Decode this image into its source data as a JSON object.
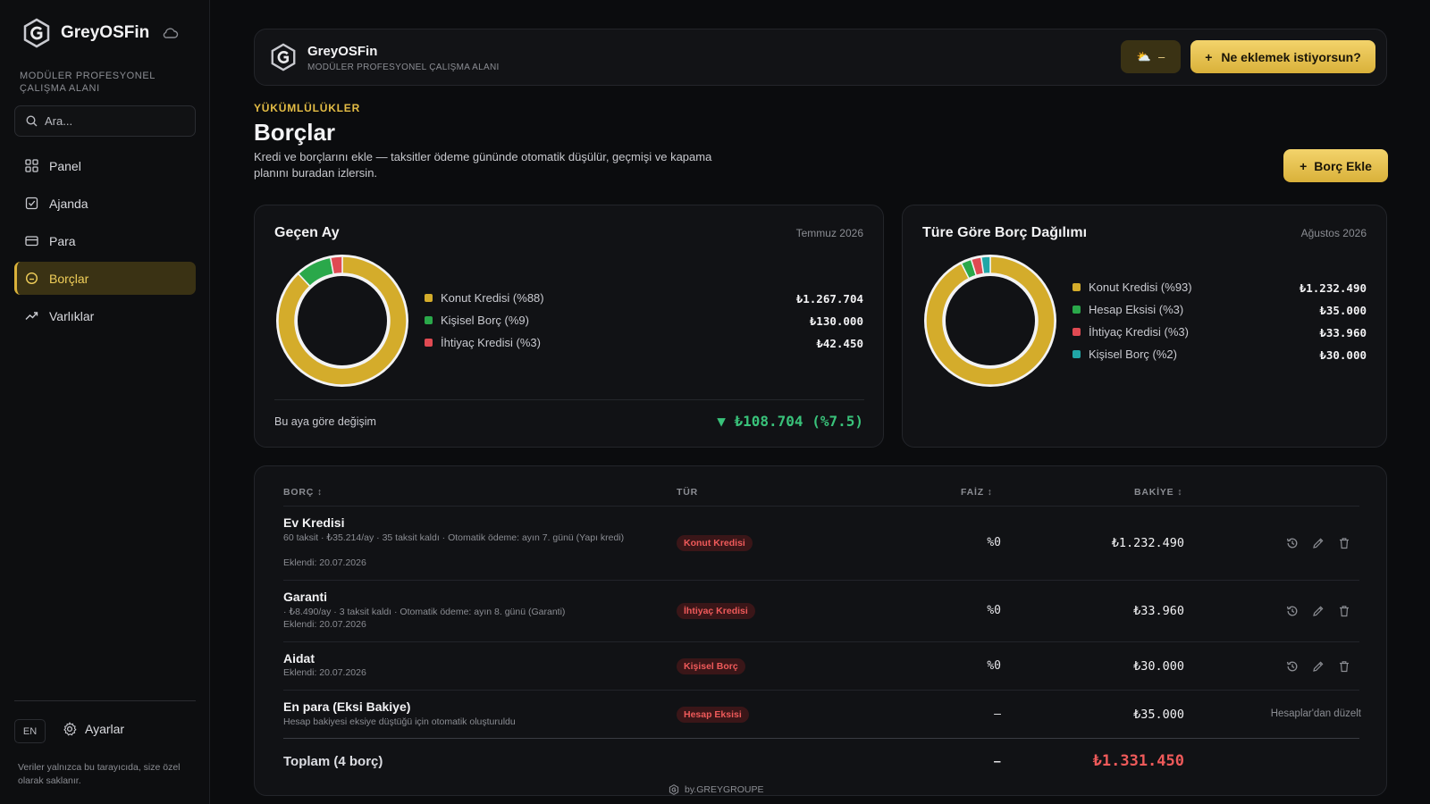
{
  "app": {
    "name": "GreyOSFin",
    "tagline": "MODÜLER PROFESYONEL ÇALIŞMA ALANI"
  },
  "sidebar": {
    "search_placeholder": "Ara...",
    "items": [
      {
        "label": "Panel",
        "icon": "grid-icon"
      },
      {
        "label": "Ajanda",
        "icon": "calendar-check-icon"
      },
      {
        "label": "Para",
        "icon": "card-icon"
      },
      {
        "label": "Borçlar",
        "icon": "circle-icon",
        "active": true
      },
      {
        "label": "Varlıklar",
        "icon": "trend-up-icon"
      }
    ],
    "lang": "EN",
    "settings_label": "Ayarlar",
    "privacy_note": "Veriler yalnızca bu tarayıcıda, size özel olarak saklanır."
  },
  "header": {
    "title": "GreyOSFin",
    "subtitle": "MODÜLER PROFESYONEL ÇALIŞMA ALANI",
    "weather_value": "–",
    "cta_label": "Ne eklemek istiyorsun?"
  },
  "page": {
    "eyebrow": "YÜKÜMLÜLÜKLER",
    "title": "Borçlar",
    "description": "Kredi ve borçlarını ekle — taksitler ödeme gününde otomatik düşülür, geçmişi ve kapama planını buradan izlersin.",
    "add_button": "Borç Ekle"
  },
  "colors": {
    "gold": "#d4ac2b",
    "green": "#2aa84a",
    "red": "#e04a52",
    "teal": "#21a6a6"
  },
  "chart_data": [
    {
      "type": "pie",
      "title": "Geçen Ay",
      "date": "Temmuz 2026",
      "categories": [
        "Konut Kredisi (%88)",
        "Kişisel Borç (%9)",
        "İhtiyaç Kredisi (%3)"
      ],
      "values": [
        1267704,
        130000,
        42450
      ],
      "value_labels": [
        "₺1.267.704",
        "₺130.000",
        "₺42.450"
      ],
      "colors": [
        "#d4ac2b",
        "#2aa84a",
        "#e04a52"
      ],
      "change_label": "Bu aya göre değişim",
      "change_value": "▼ ₺108.704 (%7.5)"
    },
    {
      "type": "pie",
      "title": "Türe Göre Borç Dağılımı",
      "date": "Ağustos 2026",
      "categories": [
        "Konut Kredisi (%93)",
        "Hesap Eksisi (%3)",
        "İhtiyaç Kredisi (%3)",
        "Kişisel Borç (%2)"
      ],
      "values": [
        1232490,
        35000,
        33960,
        30000
      ],
      "value_labels": [
        "₺1.232.490",
        "₺35.000",
        "₺33.960",
        "₺30.000"
      ],
      "colors": [
        "#d4ac2b",
        "#2aa84a",
        "#e04a52",
        "#21a6a6"
      ]
    }
  ],
  "table": {
    "headers": {
      "debt": "BORÇ",
      "type": "TÜR",
      "rate": "FAİZ",
      "balance": "BAKİYE"
    },
    "rows": [
      {
        "name": "Ev Kredisi",
        "detail": "60 taksit · ₺35.214/ay · 35 taksit kaldı · Otomatik ödeme: ayın 7. günü (Yapı kredi)",
        "added": "Eklendi: 20.07.2026",
        "type": "Konut Kredisi",
        "rate": "%0",
        "balance": "₺1.232.490"
      },
      {
        "name": "Garanti",
        "detail": "· ₺8.490/ay · 3 taksit kaldı · Otomatik ödeme: ayın 8. günü (Garanti)",
        "added": "Eklendi: 20.07.2026",
        "type": "İhtiyaç Kredisi",
        "rate": "%0",
        "balance": "₺33.960"
      },
      {
        "name": "Aidat",
        "added": "Eklendi: 20.07.2026",
        "type": "Kişisel Borç",
        "rate": "%0",
        "balance": "₺30.000"
      },
      {
        "name": "En para (Eksi Bakiye)",
        "detail": "Hesap bakiyesi eksiye düştüğü için otomatik oluşturuldu",
        "type": "Hesap Eksisi",
        "rate": "–",
        "balance": "₺35.000",
        "note": "Hesaplar'dan düzelt"
      }
    ],
    "total_label": "Toplam (4 borç)",
    "total_rate": "–",
    "total_balance": "₺1.331.450"
  },
  "footer": "by.GREYGROUPE"
}
